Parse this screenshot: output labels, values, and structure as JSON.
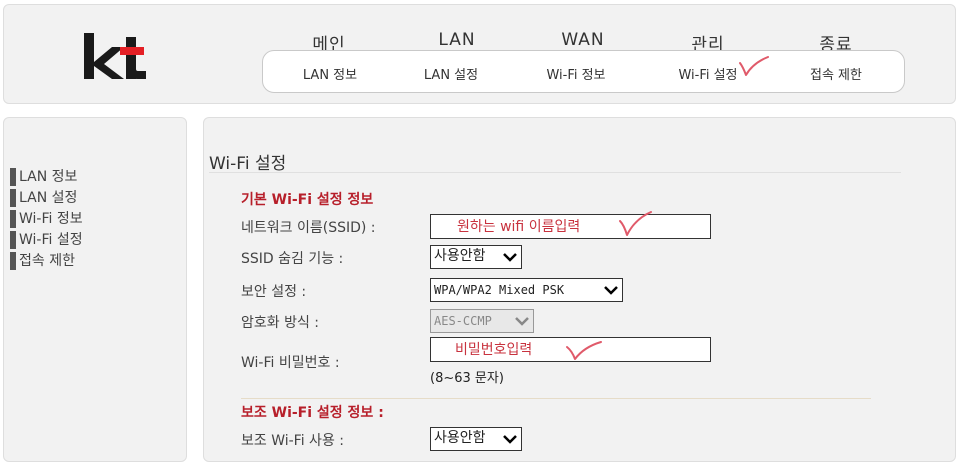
{
  "header": {
    "main_menu": [
      "메인",
      "LAN",
      "WAN",
      "관리",
      "종료"
    ],
    "sub_menu": [
      "LAN 정보",
      "LAN 설정",
      "Wi-Fi 정보",
      "Wi-Fi 설정",
      "접속 제한"
    ]
  },
  "sidebar": {
    "items": [
      "LAN 정보",
      "LAN 설정",
      "Wi-Fi 정보",
      "Wi-Fi 설정",
      "접속 제한"
    ]
  },
  "main": {
    "title": "Wi-Fi 설정",
    "basic_section": "기본 Wi-Fi 설정 정보",
    "ssid_label": "네트워크 이름(SSID) :",
    "ssid_value": "원하는 wifi 이름입력",
    "hide_label": "SSID 숨김 기능 :",
    "hide_value": "사용안함",
    "security_label": "보안 설정 :",
    "security_value": "WPA/WPA2 Mixed PSK",
    "encryption_label": "암호화 방식 :",
    "encryption_value": "AES-CCMP",
    "password_label": "Wi-Fi 비밀번호 :",
    "password_value": "비밀번호입력",
    "password_hint": "(8~63 문자)",
    "sub_section": "보조 Wi-Fi 설정 정보 :",
    "sub_use_label": "보조 Wi-Fi 사용 :",
    "sub_use_value": "사용안함"
  },
  "colors": {
    "accent_red": "#b71f2a",
    "annotation_pink": "#e05a6a"
  },
  "icons": [
    "kt-logo",
    "checkmark-annotation-icon",
    "chevron-down-icon"
  ]
}
